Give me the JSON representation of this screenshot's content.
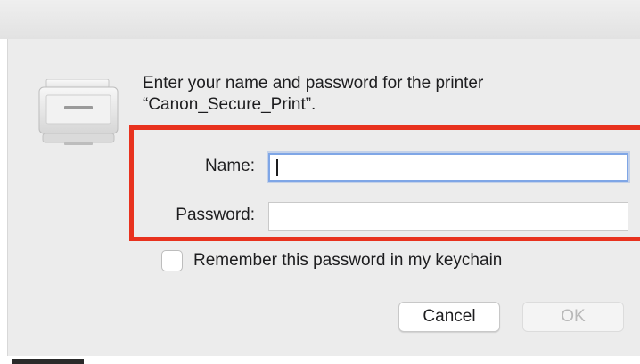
{
  "dialog": {
    "message_line1": "Enter your name and password for the printer",
    "message_line2": "“Canon_Secure_Print”.",
    "icon": "printer-icon"
  },
  "form": {
    "name_label": "Name:",
    "name_value": "",
    "password_label": "Password:",
    "password_value": "",
    "remember_label": "Remember this password in my keychain",
    "remember_checked": false
  },
  "buttons": {
    "cancel_label": "Cancel",
    "ok_label": "OK",
    "ok_enabled": false
  },
  "colors": {
    "highlight": "#e8321e",
    "focus_ring": "#7fa6e6",
    "dialog_bg": "#ececec"
  }
}
